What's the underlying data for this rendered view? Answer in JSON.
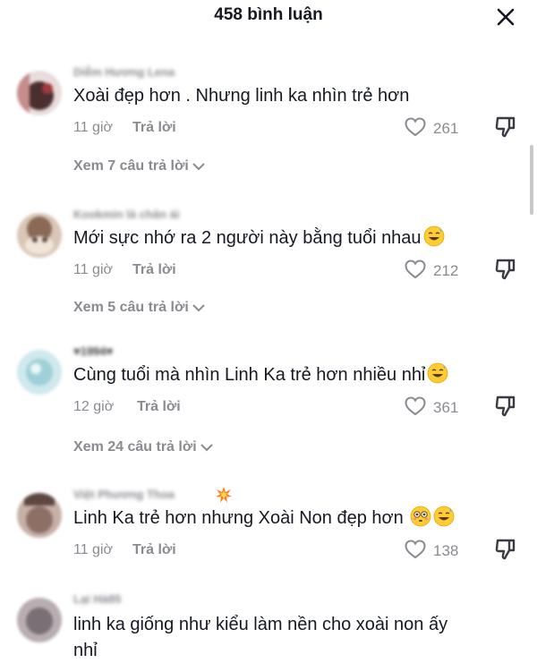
{
  "header": {
    "title": "458 bình luận"
  },
  "comments": [
    {
      "username": "Diễm Hương Lena",
      "text": "Xoài đẹp hơn . Nhưng linh ka nhìn trẻ hơn",
      "time": "11 giờ",
      "reply_label": "Trả lời",
      "likes": "261",
      "view_replies": "Xem 7 câu trả lời",
      "avatar_color": "#5a3b3b"
    },
    {
      "username": "Kookmin là chân ái",
      "text": "Mới sực nhớ ra 2 người này bằng tuổi nhau",
      "time": "11 giờ",
      "reply_label": "Trả lời",
      "likes": "212",
      "view_replies": "Xem 5 câu trả lời",
      "avatar_color": "#b59a86"
    },
    {
      "username": "1994",
      "text": "Cùng tuổi mà nhìn Linh Ka trẻ hơn nhiều nhỉ",
      "time": "12 giờ",
      "reply_label": "Trả lời",
      "likes": "361",
      "view_replies": "Xem 24 câu trả lời",
      "avatar_color": "#9fd0d8"
    },
    {
      "username": "Việt Phương Thoa",
      "text": "Linh Ka trẻ hơn nhưng Xoài Non đẹp hơn",
      "time": "11 giờ",
      "reply_label": "Trả lời",
      "likes": "138",
      "avatar_color": "#8d6f66"
    },
    {
      "username": "Lại Hà85",
      "text_line1": "linh ka giống như kiểu làm nền cho xoài non ấy",
      "text_line2": "nhỉ",
      "avatar_color": "#7a6f74"
    }
  ]
}
